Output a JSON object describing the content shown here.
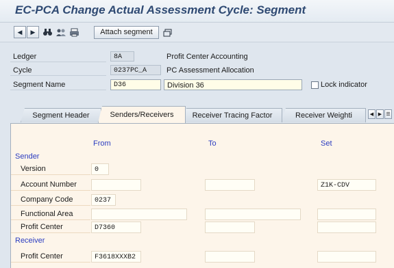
{
  "window": {
    "title": "EC-PCA Change Actual Assessment Cycle: Segment"
  },
  "toolbar": {
    "buttons": [
      "prev-arrow-icon",
      "next-arrow-icon",
      "binoculars-icon",
      "people-icon",
      "print-icon",
      "settings-icon"
    ],
    "attach_label": "Attach segment"
  },
  "header": {
    "ledger": {
      "label": "Ledger",
      "value": "8A",
      "description": "Profit Center Accounting"
    },
    "cycle": {
      "label": "Cycle",
      "value": "0237PC_A",
      "description": "PC Assessment Allocation"
    },
    "segment": {
      "label": "Segment Name",
      "value": "D36",
      "description": "Division 36"
    },
    "lock_label": "Lock indicator"
  },
  "tabs": [
    {
      "label": "Segment Header",
      "active": false
    },
    {
      "label": "Senders/Receivers",
      "active": true
    },
    {
      "label": "Receiver Tracing Factor",
      "active": false
    },
    {
      "label": "Receiver Weighti",
      "active": false
    }
  ],
  "grid": {
    "col_from": "From",
    "col_to": "To",
    "col_set": "Set",
    "sender_title": "Sender",
    "receiver_title": "Receiver",
    "sender_rows": [
      {
        "label": "Version",
        "from": "0",
        "to": "",
        "set": ""
      },
      {
        "label": "Account Number",
        "from": "",
        "to": "",
        "set": "Z1K-CDV"
      },
      {
        "label": "Company Code",
        "from": "0237",
        "to": "",
        "set": ""
      },
      {
        "label": "Functional Area",
        "from": "",
        "to": "",
        "set": ""
      },
      {
        "label": "Profit Center",
        "from": "D7360",
        "to": "",
        "set": ""
      }
    ],
    "receiver_rows": [
      {
        "label": "Profit Center",
        "from": "F3618XXXB2",
        "to": "",
        "set": ""
      }
    ]
  },
  "colors": {
    "title": "#2f4a73",
    "group_heading": "#2a3cc0",
    "tab_panel": "#fdf5ea"
  }
}
